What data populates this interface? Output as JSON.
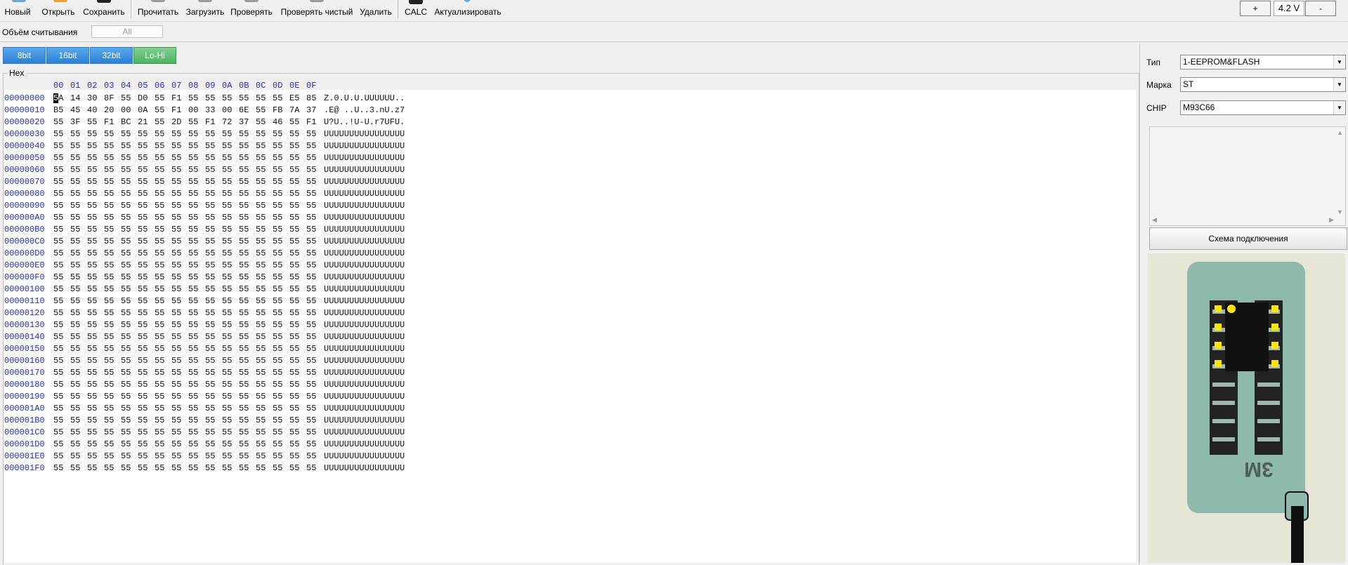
{
  "toolbar": {
    "buttons": [
      {
        "label": "Новый"
      },
      {
        "label": "Открыть"
      },
      {
        "label": "Сохранить"
      },
      {
        "label": "Прочитать"
      },
      {
        "label": "Загрузить"
      },
      {
        "label": "Проверять"
      },
      {
        "label": "Проверять чистый"
      },
      {
        "label": "Удалить"
      },
      {
        "label": "CALC"
      },
      {
        "label": "Актуализировать"
      }
    ],
    "voltage_plus": "+",
    "voltage_value": "4.2 V",
    "voltage_minus": "-"
  },
  "read_volume": {
    "label": "Объём считывания",
    "value": "All"
  },
  "bit_buttons": [
    {
      "label": "8bit",
      "color": "#2b80d3"
    },
    {
      "label": "16bit",
      "color": "#2b80d3"
    },
    {
      "label": "32bit",
      "color": "#2b80d3"
    },
    {
      "label": "Lo-Hi",
      "color": "#4fb466"
    }
  ],
  "hex": {
    "legend": "Hex",
    "columns": [
      "00",
      "01",
      "02",
      "03",
      "04",
      "05",
      "06",
      "07",
      "08",
      "09",
      "0A",
      "0B",
      "0C",
      "0D",
      "0E",
      "0F"
    ],
    "rows": [
      {
        "addr": "00000000",
        "bytes": [
          "5A",
          "14",
          "30",
          "8F",
          "55",
          "D0",
          "55",
          "F1",
          "55",
          "55",
          "55",
          "55",
          "55",
          "55",
          "E5",
          "85"
        ],
        "ascii": "Z.0.U.U.UUUUUU.."
      },
      {
        "addr": "00000010",
        "bytes": [
          "B5",
          "45",
          "40",
          "20",
          "00",
          "0A",
          "55",
          "F1",
          "00",
          "33",
          "00",
          "6E",
          "55",
          "FB",
          "7A",
          "37"
        ],
        "ascii": ".E@ ..U..3.nU.z7"
      },
      {
        "addr": "00000020",
        "bytes": [
          "55",
          "3F",
          "55",
          "F1",
          "BC",
          "21",
          "55",
          "2D",
          "55",
          "F1",
          "72",
          "37",
          "55",
          "46",
          "55",
          "F1"
        ],
        "ascii": "U?U..!U-U.r7UFU."
      },
      {
        "addr": "00000030",
        "bytes": [
          "55",
          "55",
          "55",
          "55",
          "55",
          "55",
          "55",
          "55",
          "55",
          "55",
          "55",
          "55",
          "55",
          "55",
          "55",
          "55"
        ],
        "ascii": "UUUUUUUUUUUUUUUU"
      },
      {
        "addr": "00000040",
        "bytes": [
          "55",
          "55",
          "55",
          "55",
          "55",
          "55",
          "55",
          "55",
          "55",
          "55",
          "55",
          "55",
          "55",
          "55",
          "55",
          "55"
        ],
        "ascii": "UUUUUUUUUUUUUUUU"
      },
      {
        "addr": "00000050",
        "bytes": [
          "55",
          "55",
          "55",
          "55",
          "55",
          "55",
          "55",
          "55",
          "55",
          "55",
          "55",
          "55",
          "55",
          "55",
          "55",
          "55"
        ],
        "ascii": "UUUUUUUUUUUUUUUU"
      },
      {
        "addr": "00000060",
        "bytes": [
          "55",
          "55",
          "55",
          "55",
          "55",
          "55",
          "55",
          "55",
          "55",
          "55",
          "55",
          "55",
          "55",
          "55",
          "55",
          "55"
        ],
        "ascii": "UUUUUUUUUUUUUUUU"
      },
      {
        "addr": "00000070",
        "bytes": [
          "55",
          "55",
          "55",
          "55",
          "55",
          "55",
          "55",
          "55",
          "55",
          "55",
          "55",
          "55",
          "55",
          "55",
          "55",
          "55"
        ],
        "ascii": "UUUUUUUUUUUUUUUU"
      },
      {
        "addr": "00000080",
        "bytes": [
          "55",
          "55",
          "55",
          "55",
          "55",
          "55",
          "55",
          "55",
          "55",
          "55",
          "55",
          "55",
          "55",
          "55",
          "55",
          "55"
        ],
        "ascii": "UUUUUUUUUUUUUUUU"
      },
      {
        "addr": "00000090",
        "bytes": [
          "55",
          "55",
          "55",
          "55",
          "55",
          "55",
          "55",
          "55",
          "55",
          "55",
          "55",
          "55",
          "55",
          "55",
          "55",
          "55"
        ],
        "ascii": "UUUUUUUUUUUUUUUU"
      },
      {
        "addr": "000000A0",
        "bytes": [
          "55",
          "55",
          "55",
          "55",
          "55",
          "55",
          "55",
          "55",
          "55",
          "55",
          "55",
          "55",
          "55",
          "55",
          "55",
          "55"
        ],
        "ascii": "UUUUUUUUUUUUUUUU"
      },
      {
        "addr": "000000B0",
        "bytes": [
          "55",
          "55",
          "55",
          "55",
          "55",
          "55",
          "55",
          "55",
          "55",
          "55",
          "55",
          "55",
          "55",
          "55",
          "55",
          "55"
        ],
        "ascii": "UUUUUUUUUUUUUUUU"
      },
      {
        "addr": "000000C0",
        "bytes": [
          "55",
          "55",
          "55",
          "55",
          "55",
          "55",
          "55",
          "55",
          "55",
          "55",
          "55",
          "55",
          "55",
          "55",
          "55",
          "55"
        ],
        "ascii": "UUUUUUUUUUUUUUUU"
      },
      {
        "addr": "000000D0",
        "bytes": [
          "55",
          "55",
          "55",
          "55",
          "55",
          "55",
          "55",
          "55",
          "55",
          "55",
          "55",
          "55",
          "55",
          "55",
          "55",
          "55"
        ],
        "ascii": "UUUUUUUUUUUUUUUU"
      },
      {
        "addr": "000000E0",
        "bytes": [
          "55",
          "55",
          "55",
          "55",
          "55",
          "55",
          "55",
          "55",
          "55",
          "55",
          "55",
          "55",
          "55",
          "55",
          "55",
          "55"
        ],
        "ascii": "UUUUUUUUUUUUUUUU"
      },
      {
        "addr": "000000F0",
        "bytes": [
          "55",
          "55",
          "55",
          "55",
          "55",
          "55",
          "55",
          "55",
          "55",
          "55",
          "55",
          "55",
          "55",
          "55",
          "55",
          "55"
        ],
        "ascii": "UUUUUUUUUUUUUUUU"
      },
      {
        "addr": "00000100",
        "bytes": [
          "55",
          "55",
          "55",
          "55",
          "55",
          "55",
          "55",
          "55",
          "55",
          "55",
          "55",
          "55",
          "55",
          "55",
          "55",
          "55"
        ],
        "ascii": "UUUUUUUUUUUUUUUU"
      },
      {
        "addr": "00000110",
        "bytes": [
          "55",
          "55",
          "55",
          "55",
          "55",
          "55",
          "55",
          "55",
          "55",
          "55",
          "55",
          "55",
          "55",
          "55",
          "55",
          "55"
        ],
        "ascii": "UUUUUUUUUUUUUUUU"
      },
      {
        "addr": "00000120",
        "bytes": [
          "55",
          "55",
          "55",
          "55",
          "55",
          "55",
          "55",
          "55",
          "55",
          "55",
          "55",
          "55",
          "55",
          "55",
          "55",
          "55"
        ],
        "ascii": "UUUUUUUUUUUUUUUU"
      },
      {
        "addr": "00000130",
        "bytes": [
          "55",
          "55",
          "55",
          "55",
          "55",
          "55",
          "55",
          "55",
          "55",
          "55",
          "55",
          "55",
          "55",
          "55",
          "55",
          "55"
        ],
        "ascii": "UUUUUUUUUUUUUUUU"
      },
      {
        "addr": "00000140",
        "bytes": [
          "55",
          "55",
          "55",
          "55",
          "55",
          "55",
          "55",
          "55",
          "55",
          "55",
          "55",
          "55",
          "55",
          "55",
          "55",
          "55"
        ],
        "ascii": "UUUUUUUUUUUUUUUU"
      },
      {
        "addr": "00000150",
        "bytes": [
          "55",
          "55",
          "55",
          "55",
          "55",
          "55",
          "55",
          "55",
          "55",
          "55",
          "55",
          "55",
          "55",
          "55",
          "55",
          "55"
        ],
        "ascii": "UUUUUUUUUUUUUUUU"
      },
      {
        "addr": "00000160",
        "bytes": [
          "55",
          "55",
          "55",
          "55",
          "55",
          "55",
          "55",
          "55",
          "55",
          "55",
          "55",
          "55",
          "55",
          "55",
          "55",
          "55"
        ],
        "ascii": "UUUUUUUUUUUUUUUU"
      },
      {
        "addr": "00000170",
        "bytes": [
          "55",
          "55",
          "55",
          "55",
          "55",
          "55",
          "55",
          "55",
          "55",
          "55",
          "55",
          "55",
          "55",
          "55",
          "55",
          "55"
        ],
        "ascii": "UUUUUUUUUUUUUUUU"
      },
      {
        "addr": "00000180",
        "bytes": [
          "55",
          "55",
          "55",
          "55",
          "55",
          "55",
          "55",
          "55",
          "55",
          "55",
          "55",
          "55",
          "55",
          "55",
          "55",
          "55"
        ],
        "ascii": "UUUUUUUUUUUUUUUU"
      },
      {
        "addr": "00000190",
        "bytes": [
          "55",
          "55",
          "55",
          "55",
          "55",
          "55",
          "55",
          "55",
          "55",
          "55",
          "55",
          "55",
          "55",
          "55",
          "55",
          "55"
        ],
        "ascii": "UUUUUUUUUUUUUUUU"
      },
      {
        "addr": "000001A0",
        "bytes": [
          "55",
          "55",
          "55",
          "55",
          "55",
          "55",
          "55",
          "55",
          "55",
          "55",
          "55",
          "55",
          "55",
          "55",
          "55",
          "55"
        ],
        "ascii": "UUUUUUUUUUUUUUUU"
      },
      {
        "addr": "000001B0",
        "bytes": [
          "55",
          "55",
          "55",
          "55",
          "55",
          "55",
          "55",
          "55",
          "55",
          "55",
          "55",
          "55",
          "55",
          "55",
          "55",
          "55"
        ],
        "ascii": "UUUUUUUUUUUUUUUU"
      },
      {
        "addr": "000001C0",
        "bytes": [
          "55",
          "55",
          "55",
          "55",
          "55",
          "55",
          "55",
          "55",
          "55",
          "55",
          "55",
          "55",
          "55",
          "55",
          "55",
          "55"
        ],
        "ascii": "UUUUUUUUUUUUUUUU"
      },
      {
        "addr": "000001D0",
        "bytes": [
          "55",
          "55",
          "55",
          "55",
          "55",
          "55",
          "55",
          "55",
          "55",
          "55",
          "55",
          "55",
          "55",
          "55",
          "55",
          "55"
        ],
        "ascii": "UUUUUUUUUUUUUUUU"
      },
      {
        "addr": "000001E0",
        "bytes": [
          "55",
          "55",
          "55",
          "55",
          "55",
          "55",
          "55",
          "55",
          "55",
          "55",
          "55",
          "55",
          "55",
          "55",
          "55",
          "55"
        ],
        "ascii": "UUUUUUUUUUUUUUUU"
      },
      {
        "addr": "000001F0",
        "bytes": [
          "55",
          "55",
          "55",
          "55",
          "55",
          "55",
          "55",
          "55",
          "55",
          "55",
          "55",
          "55",
          "55",
          "55",
          "55",
          "55"
        ],
        "ascii": "UUUUUUUUUUUUUUUU"
      }
    ]
  },
  "chip_panel": {
    "type_label": "Тип",
    "type_value": "1-EEPROM&FLASH",
    "brand_label": "Марка",
    "brand_value": "ST",
    "chip_label": "CHIP",
    "chip_value": "M93C66",
    "schema_button": "Схема подключения",
    "adapter_marking": "3M"
  },
  "colors": {
    "address": "#1f2fc7",
    "button_blue": "#2b80d3",
    "button_green": "#4fb466",
    "adapter_green": "#8fb9ac",
    "pin_yellow": "#ffe600"
  }
}
